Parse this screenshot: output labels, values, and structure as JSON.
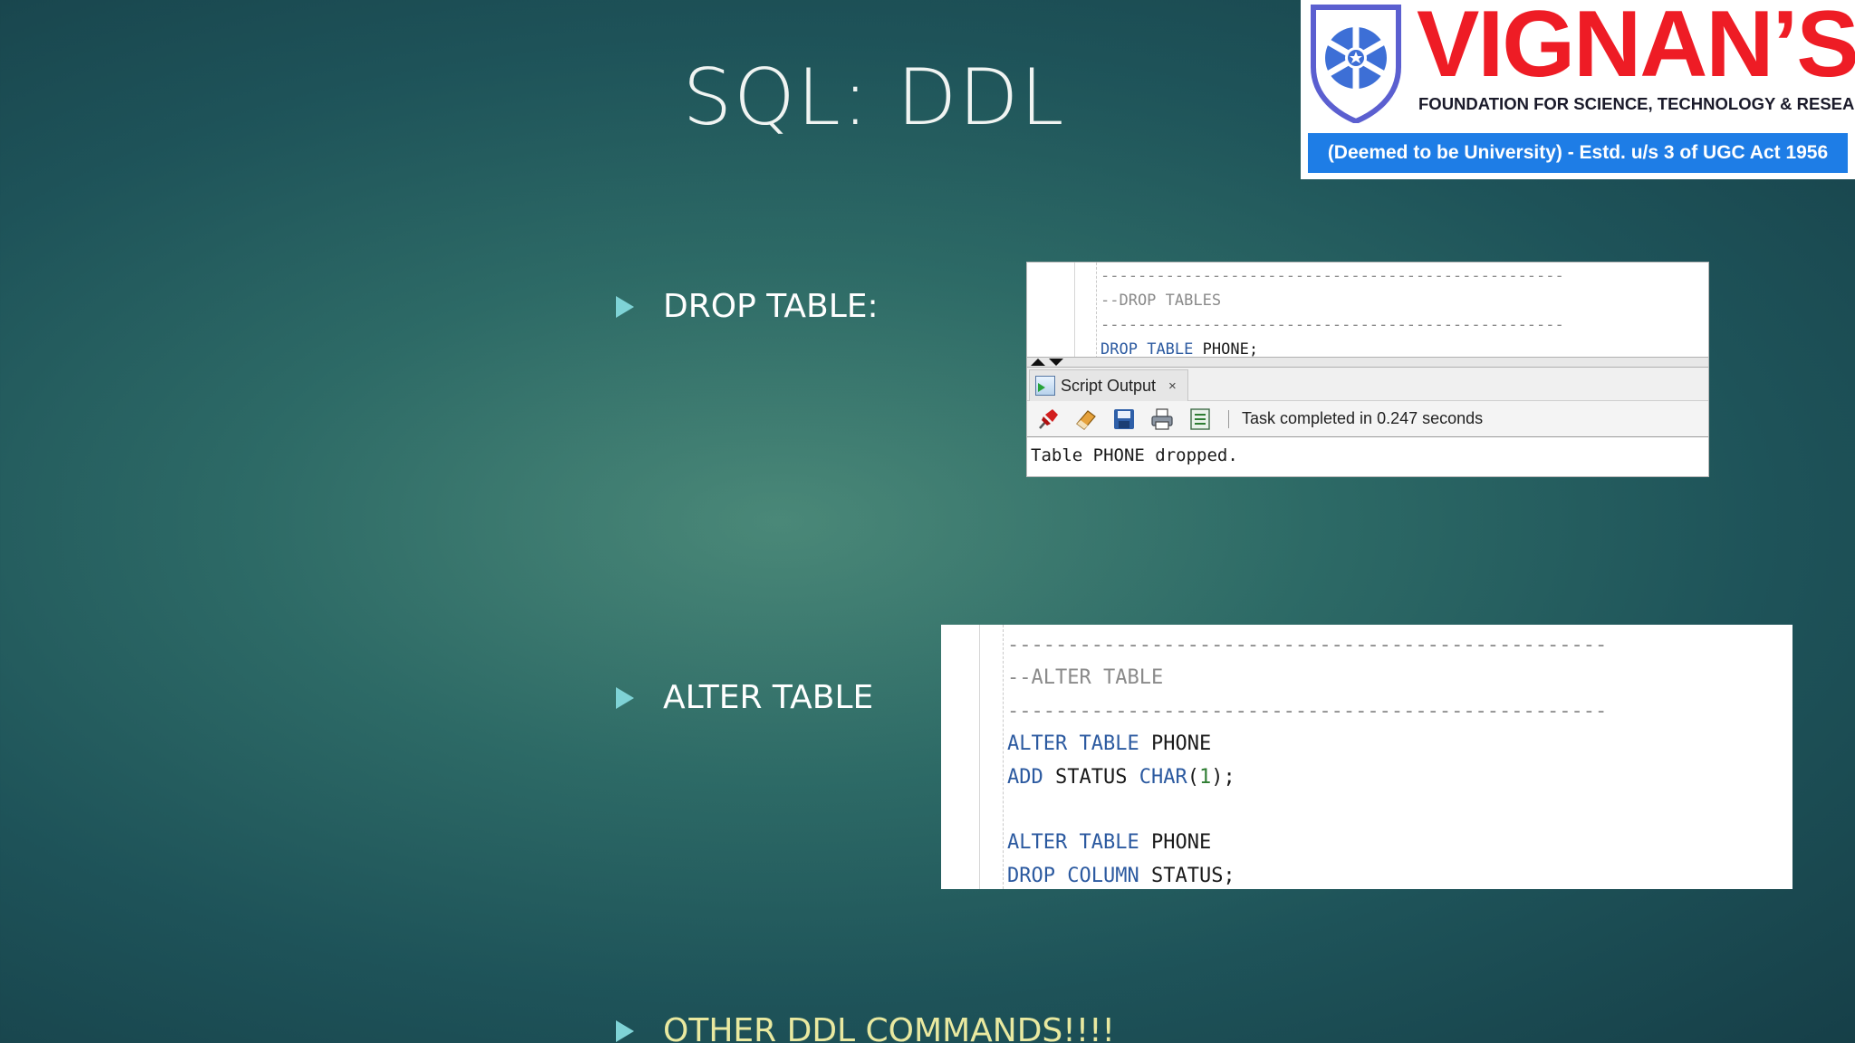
{
  "slide": {
    "title": "SQL: DDL",
    "bullets": [
      {
        "label": "DROP TABLE:"
      },
      {
        "label": "ALTER TABLE"
      },
      {
        "label": "OTHER DDL COMMANDS!!!!"
      }
    ]
  },
  "logo": {
    "name": "VIGNAN’S",
    "foundation": "FOUNDATION FOR SCIENCE, TECHNOLOGY & RESEARCH",
    "tagline": "(Deemed to be University) - Estd. u/s 3 of UGC Act 1956",
    "colors": {
      "name": "#ee1c25",
      "band": "#1e7de6",
      "emblem": "#5b5fd0"
    }
  },
  "drop_example": {
    "editor": {
      "separator": "--------------------------------------------------",
      "comment": "--DROP TABLES",
      "statement": {
        "keyword1": "DROP",
        "keyword2": "TABLE",
        "rest": "PHONE;"
      }
    },
    "output_panel": {
      "tab_label": "Script Output",
      "tab_close": "×",
      "toolbar_icons": [
        "pin-icon",
        "eraser-icon",
        "save-icon",
        "print-icon",
        "open-file-icon"
      ],
      "status": "Task completed in 0.247 seconds",
      "output_text": "Table PHONE dropped."
    }
  },
  "alter_example": {
    "separator": "--------------------------------------------------",
    "comment": "--ALTER TABLE",
    "lines": [
      {
        "kw1": "ALTER",
        "kw2": "TABLE",
        "rest": " PHONE"
      },
      {
        "kw1": "ADD",
        "mid": " STATUS ",
        "kw2": "CHAR",
        "paren_open": "(",
        "num": "1",
        "paren_close": ");"
      },
      {
        "kw1": "ALTER",
        "kw2": "TABLE",
        "rest": " PHONE"
      },
      {
        "kw1": "DROP",
        "kw2": "COLUMN",
        "rest": " STATUS;"
      }
    ]
  }
}
